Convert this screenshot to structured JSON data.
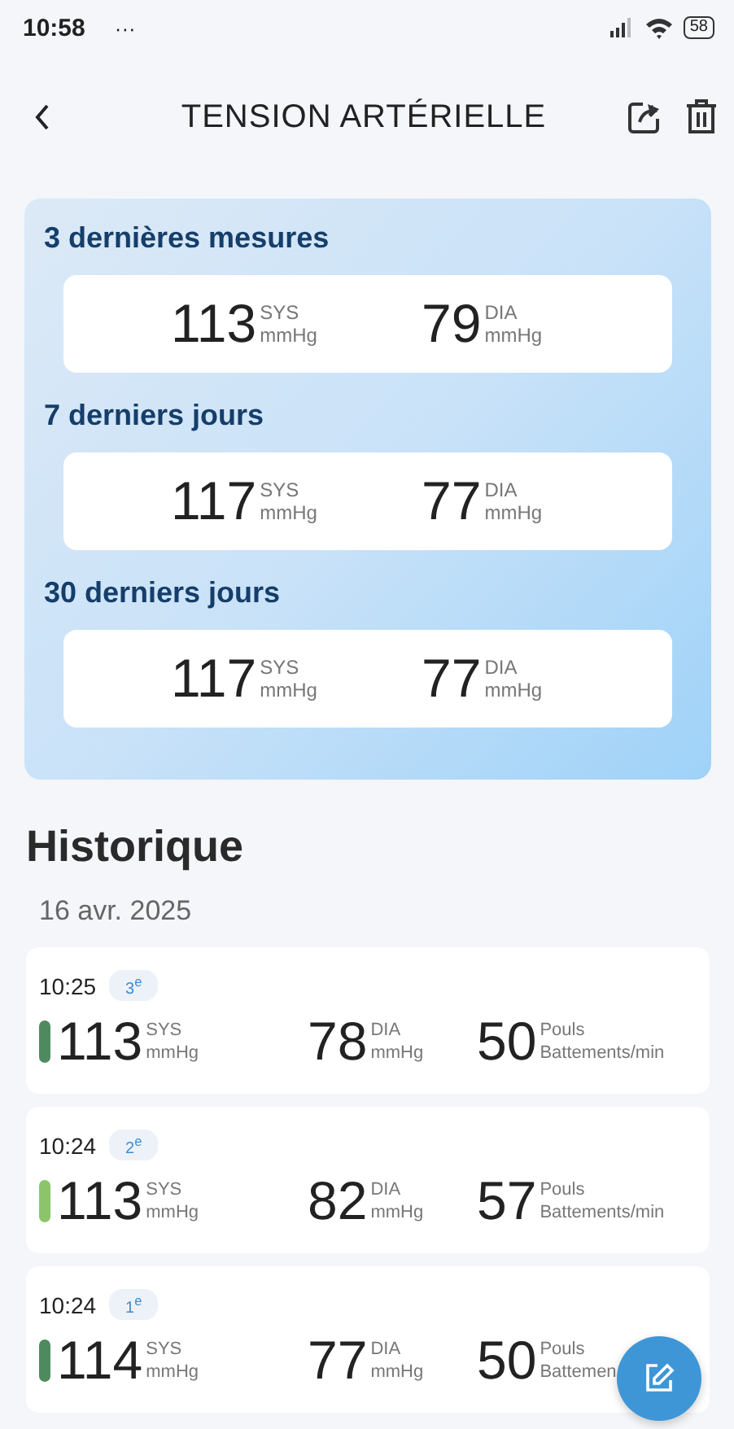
{
  "status_bar": {
    "time": "10:58",
    "more": "···",
    "battery": "58"
  },
  "header": {
    "title": "TENSION ARTÉRIELLE"
  },
  "summary": [
    {
      "title": "3 dernières mesures",
      "values": [
        {
          "value": "113",
          "label": "SYS",
          "unit": "mmHg"
        },
        {
          "value": "79",
          "label": "DIA",
          "unit": "mmHg"
        }
      ]
    },
    {
      "title": "7 derniers jours",
      "values": [
        {
          "value": "117",
          "label": "SYS",
          "unit": "mmHg"
        },
        {
          "value": "77",
          "label": "DIA",
          "unit": "mmHg"
        }
      ]
    },
    {
      "title": "30 derniers jours",
      "values": [
        {
          "value": "117",
          "label": "SYS",
          "unit": "mmHg"
        },
        {
          "value": "77",
          "label": "DIA",
          "unit": "mmHg"
        }
      ]
    }
  ],
  "history": {
    "title": "Historique",
    "date": "16 avr. 2025",
    "entries": [
      {
        "time": "10:25",
        "badge": "3$^{e}$",
        "color": "#4f8a5f",
        "values": [
          {
            "value": "113",
            "label": "SYS",
            "unit": "mmHg"
          },
          {
            "value": "78",
            "label": "DIA",
            "unit": "mmHg"
          },
          {
            "value": "50",
            "label": "Pouls",
            "unit": "Battements/min"
          }
        ]
      },
      {
        "time": "10:24",
        "badge": "2$^{e}$",
        "color": "#8cc46a",
        "values": [
          {
            "value": "113",
            "label": "SYS",
            "unit": "mmHg"
          },
          {
            "value": "82",
            "label": "DIA",
            "unit": "mmHg"
          },
          {
            "value": "57",
            "label": "Pouls",
            "unit": "Battements/min"
          }
        ]
      },
      {
        "time": "10:24",
        "badge": "1$^{e}$",
        "color": "#4f8a5f",
        "values": [
          {
            "value": "114",
            "label": "SYS",
            "unit": "mmHg"
          },
          {
            "value": "77",
            "label": "DIA",
            "unit": "mmHg"
          },
          {
            "value": "50",
            "label": "Pouls",
            "unit": "Battemen"
          }
        ]
      }
    ]
  }
}
